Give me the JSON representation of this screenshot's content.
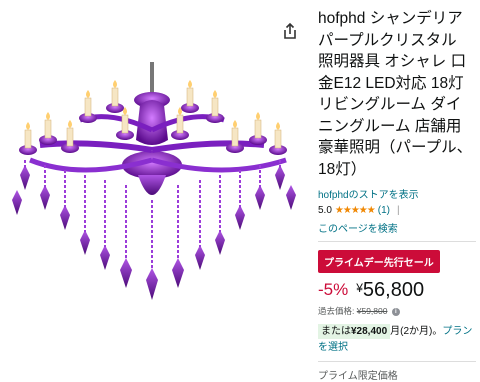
{
  "product": {
    "title": "hofphd シャンデリア パープルクリスタル 照明器具 オシャレ 口金E12 LED対応 18灯 リビングルーム ダイニングルーム 店舗用 豪華照明（パープル、18灯）",
    "store_link": "hofphdのストアを表示",
    "rating_value": "5.0",
    "stars": "★★★★★",
    "rating_count": "(1)",
    "rating_sep": "|",
    "search_page": "このページを検索"
  },
  "deal": {
    "badge": "プライムデー先行セール",
    "discount": "-5%",
    "currency": "¥",
    "price": "56,800",
    "past_price_label": "過去価格:",
    "past_price": "¥59,800",
    "info_icon": "i"
  },
  "installment": {
    "prefix": "または",
    "amount": "¥28,400",
    "suffix": "月(2か月)。",
    "plan_link": "プランを選択"
  },
  "limited_label": "プライム限定価格",
  "icons": {
    "share": "share-icon",
    "info": "info-icon"
  },
  "colors": {
    "accent_red": "#cc0c39",
    "link": "#007185",
    "star": "#f08804",
    "crystal": "#8a1fc4"
  }
}
